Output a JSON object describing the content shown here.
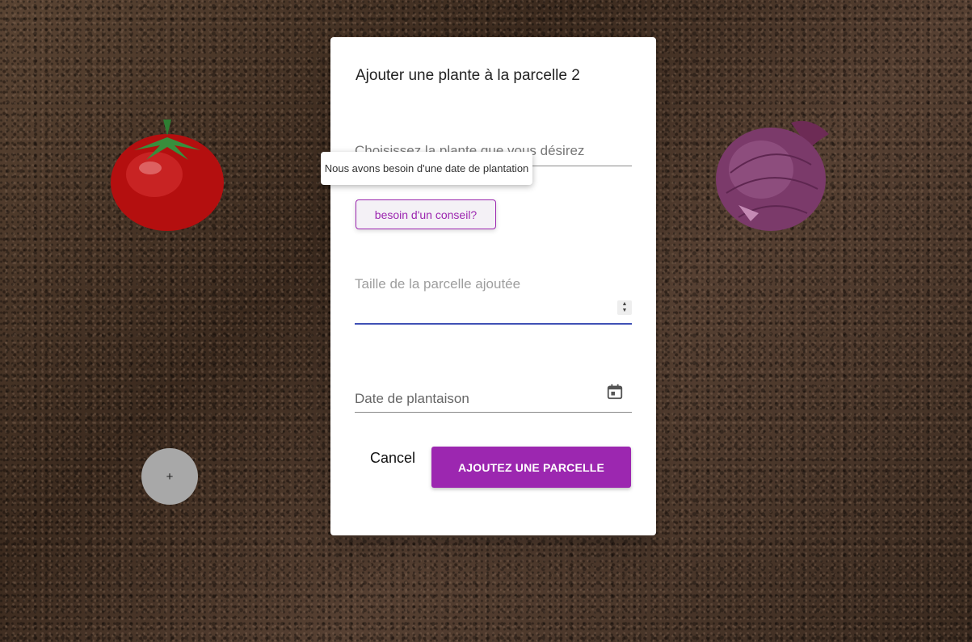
{
  "dialog": {
    "title": "Ajouter une plante à la parcelle 2",
    "plant_field": {
      "placeholder": "Choisissez la plante que vous désirez"
    },
    "hint_button": {
      "label": "besoin d'un conseil?"
    },
    "tooltip": {
      "text": "Nous avons besoin d'une date de plantation"
    },
    "size_field": {
      "label": "Taille de la parcelle ajoutée",
      "value": ""
    },
    "date_field": {
      "placeholder": "Date de plantaison"
    },
    "cancel_label": "Cancel",
    "submit_label": "AJOUTEZ UNE PARCELLE"
  },
  "fab": {
    "label": "+"
  },
  "icons": {
    "calendar": "calendar-icon",
    "spinner": "number-spinner-icon"
  },
  "colors": {
    "accent": "#9c27b0",
    "focus_underline": "#3f51b5",
    "soil": "#4a3728"
  }
}
